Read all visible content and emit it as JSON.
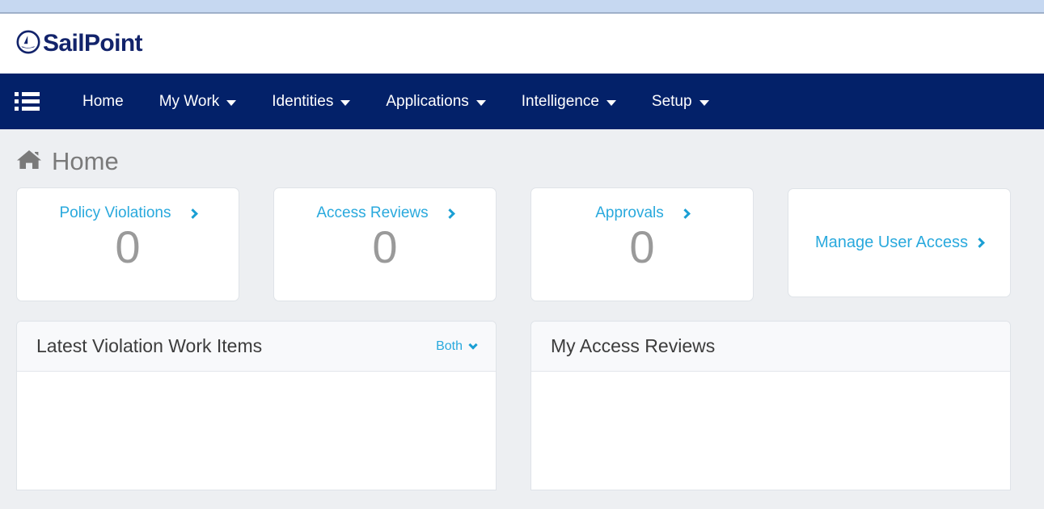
{
  "brand": {
    "name": "SailPoint",
    "logo_icon": "sailboat-circle-icon",
    "accent_navy": "#032169",
    "accent_cyan": "#29a9dd"
  },
  "topbar": {
    "band_color": "#c6d8f1"
  },
  "nav": {
    "menu_icon": "list-menu-icon",
    "items": [
      {
        "label": "Home",
        "has_dropdown": false
      },
      {
        "label": "My Work",
        "has_dropdown": true
      },
      {
        "label": "Identities",
        "has_dropdown": true
      },
      {
        "label": "Applications",
        "has_dropdown": true
      },
      {
        "label": "Intelligence",
        "has_dropdown": true
      },
      {
        "label": "Setup",
        "has_dropdown": true
      }
    ]
  },
  "page": {
    "icon": "home-icon",
    "title": "Home"
  },
  "cards": [
    {
      "label": "Policy Violations",
      "value": "0",
      "chevron": "chevron-right-icon"
    },
    {
      "label": "Access Reviews",
      "value": "0",
      "chevron": "chevron-right-icon"
    },
    {
      "label": "Approvals",
      "value": "0",
      "chevron": "chevron-right-icon"
    }
  ],
  "link_card": {
    "label": "Manage User Access",
    "chevron": "chevron-right-icon"
  },
  "panels": [
    {
      "title": "Latest Violation Work Items",
      "filter": {
        "label": "Both",
        "caret": "chevron-down-icon"
      },
      "body": ""
    },
    {
      "title": "My Access Reviews",
      "body": ""
    }
  ]
}
